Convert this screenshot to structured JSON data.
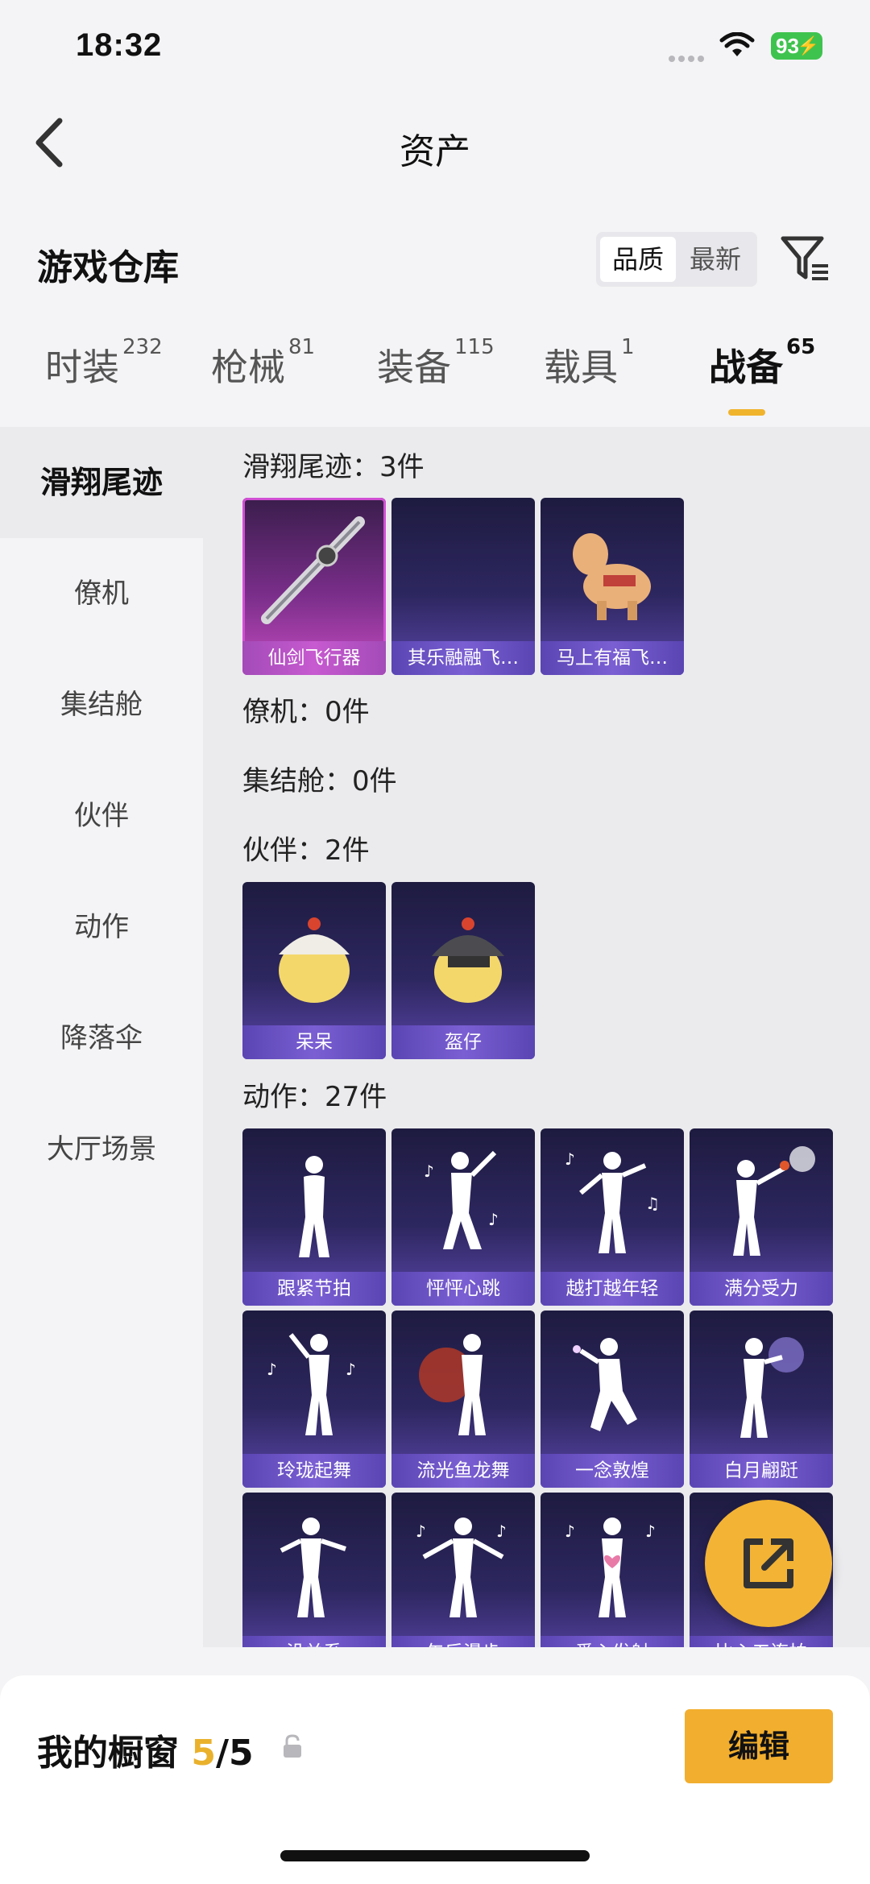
{
  "status": {
    "time": "18:32",
    "battery": "93"
  },
  "nav": {
    "title": "资产"
  },
  "warehouse": {
    "title": "游戏仓库",
    "sort_quality": "品质",
    "sort_latest": "最新"
  },
  "tabs": [
    {
      "label": "时装",
      "count": "232"
    },
    {
      "label": "枪械",
      "count": "81"
    },
    {
      "label": "装备",
      "count": "115"
    },
    {
      "label": "载具",
      "count": "1"
    },
    {
      "label": "战备",
      "count": "65"
    }
  ],
  "sidebar": [
    "滑翔尾迹",
    "僚机",
    "集结舱",
    "伙伴",
    "动作",
    "降落伞",
    "大厅场景"
  ],
  "sections": {
    "trail": {
      "title": "滑翔尾迹：3件",
      "items": [
        "仙剑飞行器",
        "其乐融融飞…",
        "马上有福飞…"
      ]
    },
    "wingman": {
      "title": "僚机：0件"
    },
    "capsule": {
      "title": "集结舱：0件"
    },
    "partner": {
      "title": "伙伴：2件",
      "items": [
        "呆呆",
        "盔仔"
      ]
    },
    "emote": {
      "title": "动作：27件",
      "items": [
        "跟紧节拍",
        "怦怦心跳",
        "越打越年轻",
        "满分受力",
        "玲珑起舞",
        "流光鱼龙舞",
        "一念敦煌",
        "白月翩跹",
        "没关系",
        "午后漫步",
        "爱心发射",
        "比心五连拍"
      ]
    }
  },
  "bottom": {
    "label": "我的橱窗",
    "count": "5",
    "total": "/5",
    "edit": "编辑"
  },
  "colors": {
    "accent": "#f2ae2e",
    "card_purple": "#5b45a8",
    "card_pink": "#c64bc0"
  },
  "icons": [
    "back-icon",
    "filter-icon",
    "wifi-icon",
    "lock-icon",
    "share-icon"
  ]
}
